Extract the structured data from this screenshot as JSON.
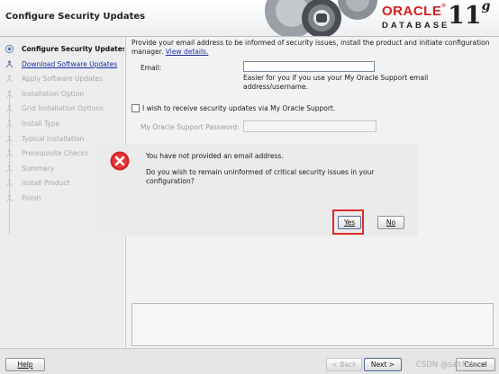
{
  "window": {
    "title": "Configure Security Updates",
    "brand": "ORACLE",
    "brand_reg": "®",
    "product": "DATABASE",
    "version": "11",
    "version_suffix": "g",
    "brand_color": "#d12020"
  },
  "steps": [
    {
      "label": "Configure Security Updates",
      "state": "active"
    },
    {
      "label": "Download Software Updates",
      "state": "link"
    },
    {
      "label": "Apply Software Updates",
      "state": "disabled"
    },
    {
      "label": "Installation Option",
      "state": "disabled"
    },
    {
      "label": "Grid Installation Options",
      "state": "disabled"
    },
    {
      "label": "Install Type",
      "state": "disabled"
    },
    {
      "label": "Typical Installation",
      "state": "disabled"
    },
    {
      "label": "Prerequisite Checks",
      "state": "disabled"
    },
    {
      "label": "Summary",
      "state": "disabled"
    },
    {
      "label": "Install Product",
      "state": "disabled"
    },
    {
      "label": "Finish",
      "state": "disabled"
    }
  ],
  "main": {
    "intro": "Provide your email address to be informed of security issues, install the product and initiate configuration manager.",
    "view_details": "View details.",
    "email_label": "Email:",
    "email_value": "",
    "email_hint": "Easier for you if you use your My Oracle Support email address/username.",
    "security_checkbox_label": "I wish to receive security updates via My Oracle Support.",
    "security_checkbox_checked": false,
    "password_label": "My Oracle Support Password:",
    "password_value": ""
  },
  "dialog": {
    "icon": "error-icon",
    "message": "You have not provided an email address.",
    "question": "Do you wish to remain uninformed of critical security issues in your configuration?",
    "yes_label": "Yes",
    "no_label": "No",
    "highlight_color": "#e02a2a"
  },
  "footer": {
    "help_label": "Help",
    "back_label": "< Back",
    "next_label": "Next >",
    "cancel_label": "Cancel",
    "watermark": "CSDN @saltfish"
  }
}
